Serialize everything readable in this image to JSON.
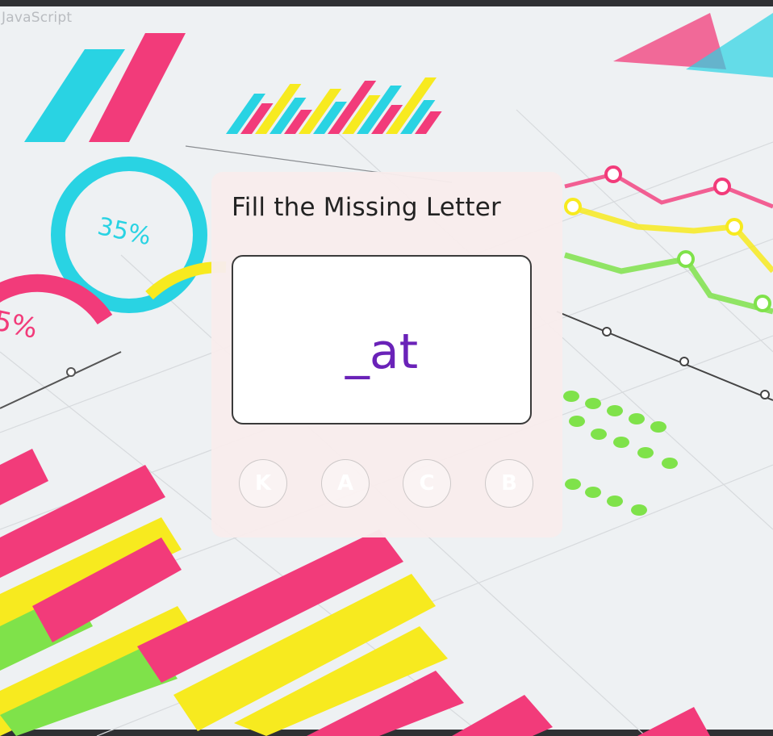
{
  "header": {
    "corner_text": "JavaScript"
  },
  "game": {
    "title": "Fill the Missing Letter",
    "word": "_at",
    "options": [
      "K",
      "A",
      "C",
      "B"
    ]
  },
  "background": {
    "percent_labels": [
      "35%",
      "5%"
    ],
    "colors": {
      "pink": "#f23b7a",
      "cyan": "#29d3e3",
      "yellow": "#f7ea1f",
      "green": "#7fe24a"
    }
  },
  "colors": {
    "card": "#f8ecec",
    "word": "#6a22b8",
    "frame": "#2f3033"
  }
}
